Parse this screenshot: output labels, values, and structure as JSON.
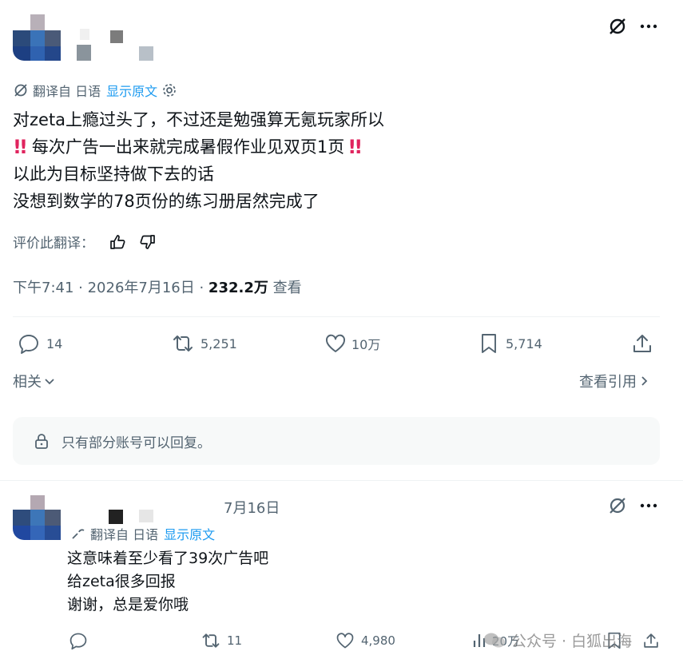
{
  "post": {
    "translated_from": "翻译自 日语",
    "show_original": "显示原文",
    "lines": [
      "对zeta上瘾过头了，不过还是勉强算无氪玩家所以",
      "每次广告一出来就完成暑假作业见双页1页",
      "以此为目标坚持做下去的话",
      "没想到数学的78页份的练习册居然完成了"
    ],
    "rate_translation": "评价此翻译：",
    "time": "下午7:41 · 2026年7月16日 · ",
    "views_count": "232.2万",
    "views_label": " 查看",
    "stats": {
      "replies": "14",
      "reposts": "5,251",
      "likes": "10万",
      "bookmarks": "5,714"
    },
    "related": "相关",
    "view_quotes": "查看引用",
    "reply_restriction": "只有部分账号可以回复。"
  },
  "reply": {
    "date": "7月16日",
    "translated_from": "翻译自 日语",
    "show_original": "显示原文",
    "lines": [
      "这意味着至少看了39次广告吧",
      "给zeta很多回报",
      "谢谢，总是爱你哦"
    ],
    "stats": {
      "replies": "",
      "reposts": "11",
      "likes": "4,980",
      "views": "20万"
    }
  },
  "watermark": "公众号 · 白狐出海",
  "colors": {
    "text": "#0f1419",
    "secondary": "#536471",
    "link": "#1d9bf0",
    "divider": "#eff3f4",
    "restriction_bg": "#f7f9f9",
    "alert_red": "#e0245e"
  },
  "icons": [
    "grok-icon",
    "more-icon",
    "translate-icon",
    "gear-icon",
    "reply-icon",
    "repost-icon",
    "like-icon",
    "bookmark-icon",
    "share-icon",
    "lock-icon",
    "thumbs-up-icon",
    "thumbs-down-icon",
    "views-icon",
    "chevron-down-icon",
    "chevron-right-icon"
  ]
}
